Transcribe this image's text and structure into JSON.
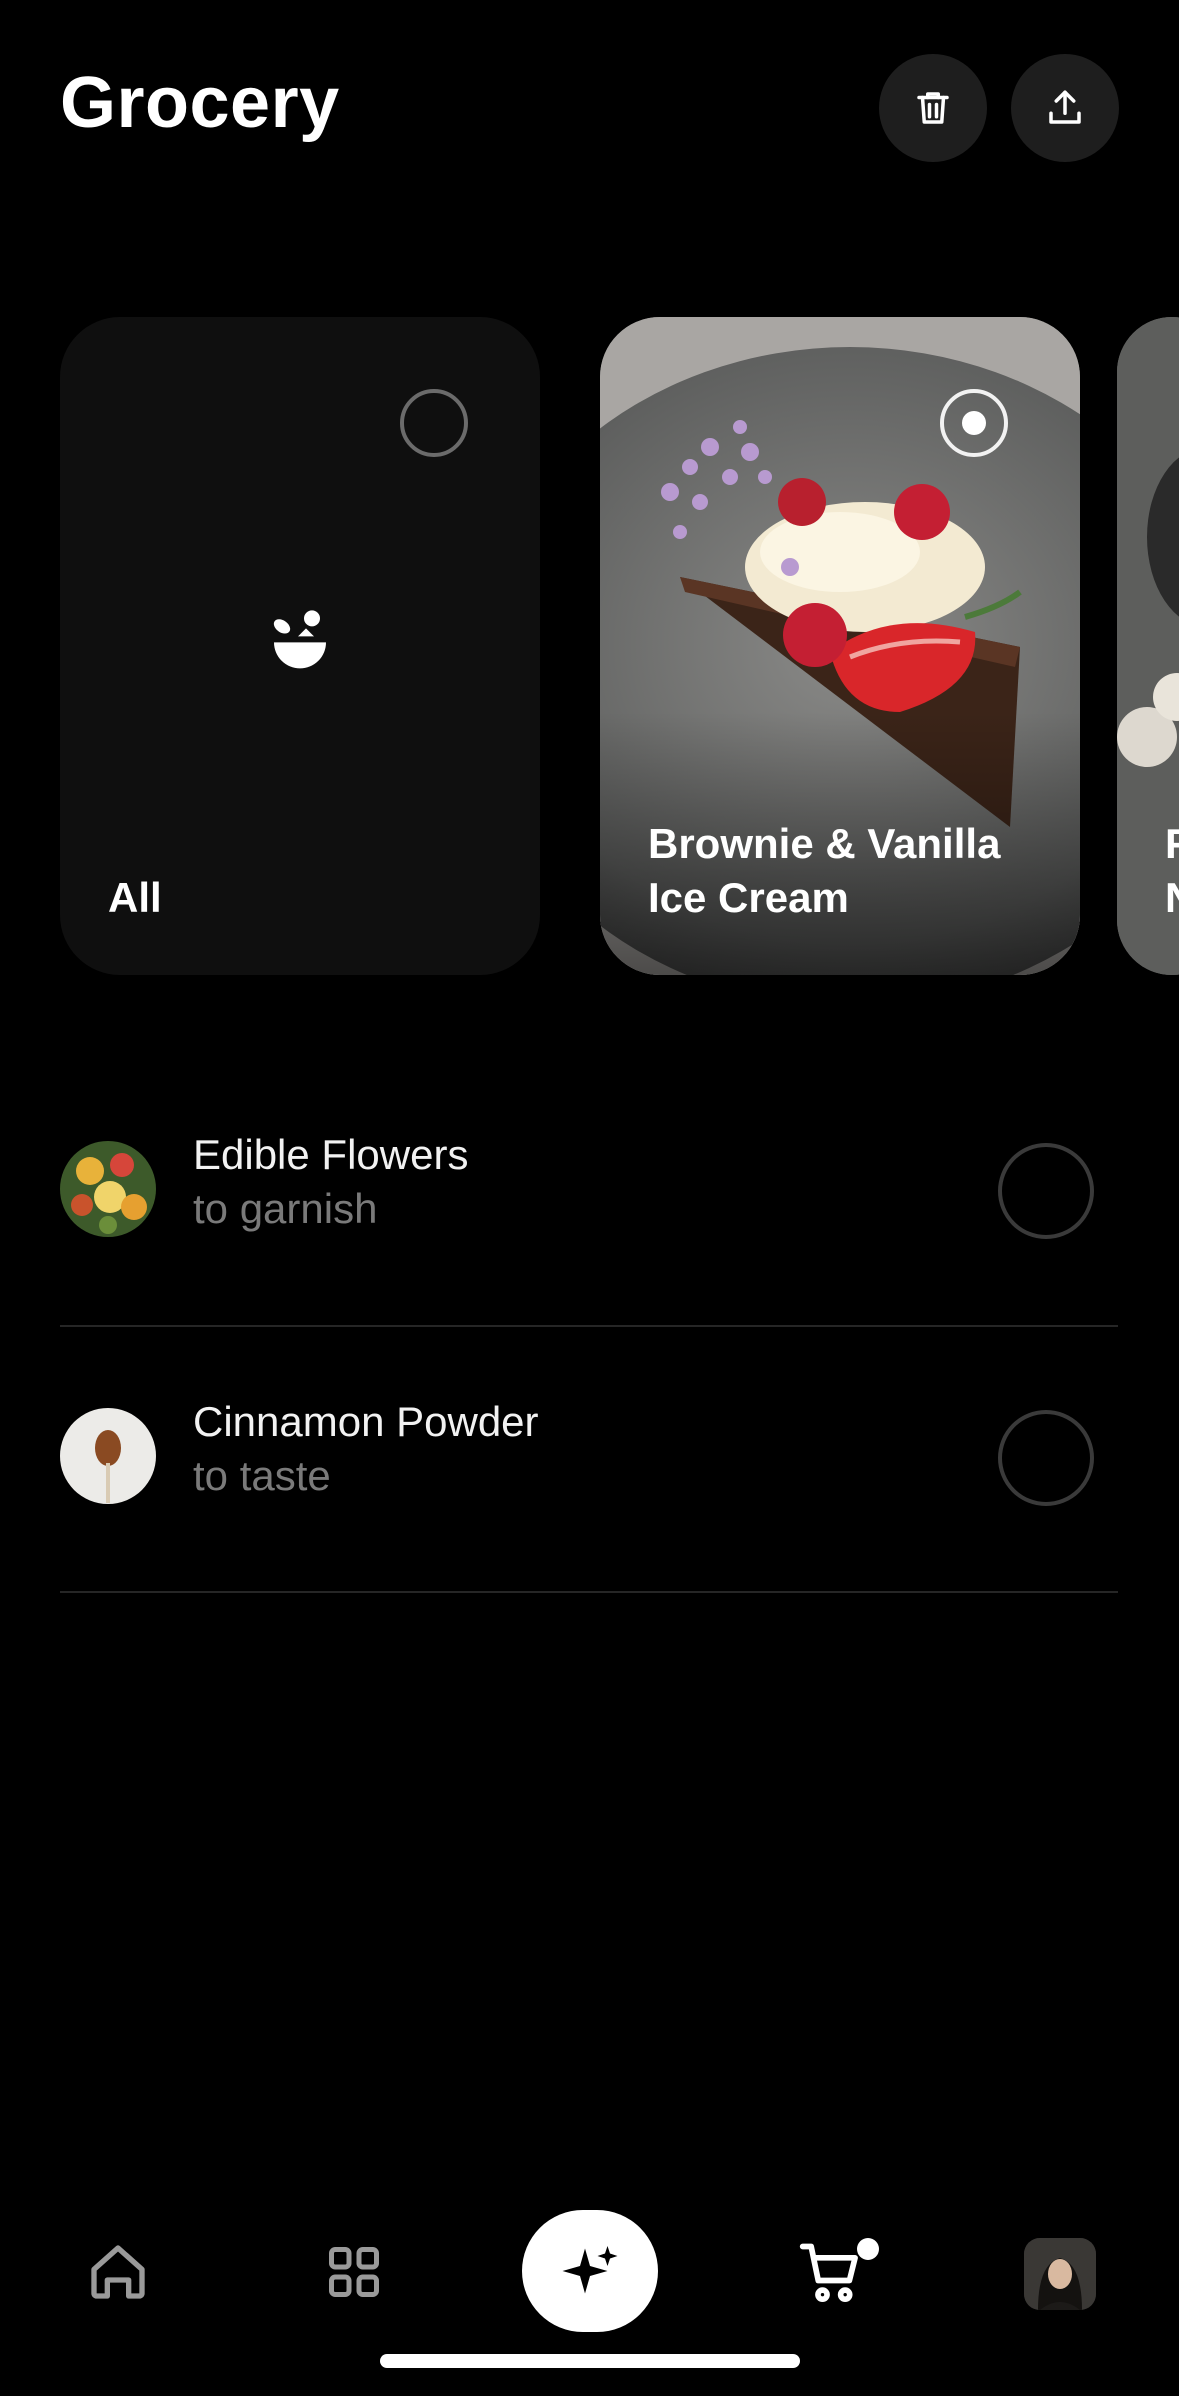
{
  "header": {
    "title": "Grocery",
    "actions": [
      {
        "icon": "trash-icon"
      },
      {
        "icon": "share-icon"
      }
    ]
  },
  "recipes": [
    {
      "label": "All",
      "icon": "bowl-icon",
      "selected": false
    },
    {
      "label_line1": "Brownie & Vanilla",
      "label_line2": "Ice Cream",
      "selected": true
    },
    {
      "label_partial_line1": "F",
      "label_partial_line2": "N"
    }
  ],
  "items": [
    {
      "name": "Edible Flowers",
      "quantity": "to garnish",
      "checked": false
    },
    {
      "name": "Cinnamon Powder",
      "quantity": "to taste",
      "checked": false
    }
  ],
  "bottom_nav": {
    "items": [
      "home-icon",
      "grid-icon",
      "sparkle-icon",
      "cart-icon",
      "profile-avatar"
    ],
    "active": "sparkle-icon",
    "cart_has_badge": true
  },
  "colors": {
    "background": "#000000",
    "card": "#0f0f0f",
    "header_button": "#1e1e1e",
    "muted_text": "#7a7a7a"
  }
}
